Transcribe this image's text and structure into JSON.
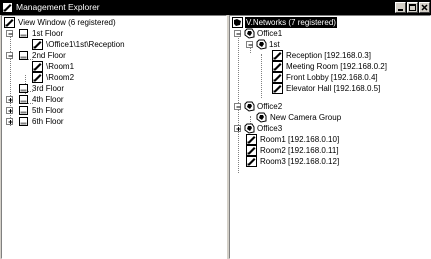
{
  "window": {
    "title": "Management Explorer",
    "minimize_icon": "minimize-icon",
    "maximize_icon": "maximize-icon",
    "close_icon": "close-icon"
  },
  "left_tree": {
    "root": "View Window (6 registered)",
    "floor1": "1st Floor",
    "floor1_view1": "\\Office1\\1st\\Reception",
    "floor2": "2nd Floor",
    "floor2_view1": "\\Room1",
    "floor2_view2": "\\Room2",
    "floor3": "3rd Floor",
    "floor4": "4th Floor",
    "floor5": "5th Floor",
    "floor6": "6th Floor"
  },
  "right_tree": {
    "root": "V.Networks (7 registered)",
    "office1": "Office1",
    "office1_1st": "1st",
    "cam_reception": "Reception [192.168.0.3]",
    "cam_meeting": "Meeting Room [192.168.0.2]",
    "cam_lobby": "Front Lobby [192.168.0.4]",
    "cam_elevator": "Elevator Hall [192.168.0.5]",
    "office2": "Office2",
    "office2_group": "New Camera Group",
    "office3": "Office3",
    "room1": "Room1 [192.168.0.10]",
    "room2": "Room2 [192.168.0.11]",
    "room3": "Room3 [192.168.0.12]"
  }
}
